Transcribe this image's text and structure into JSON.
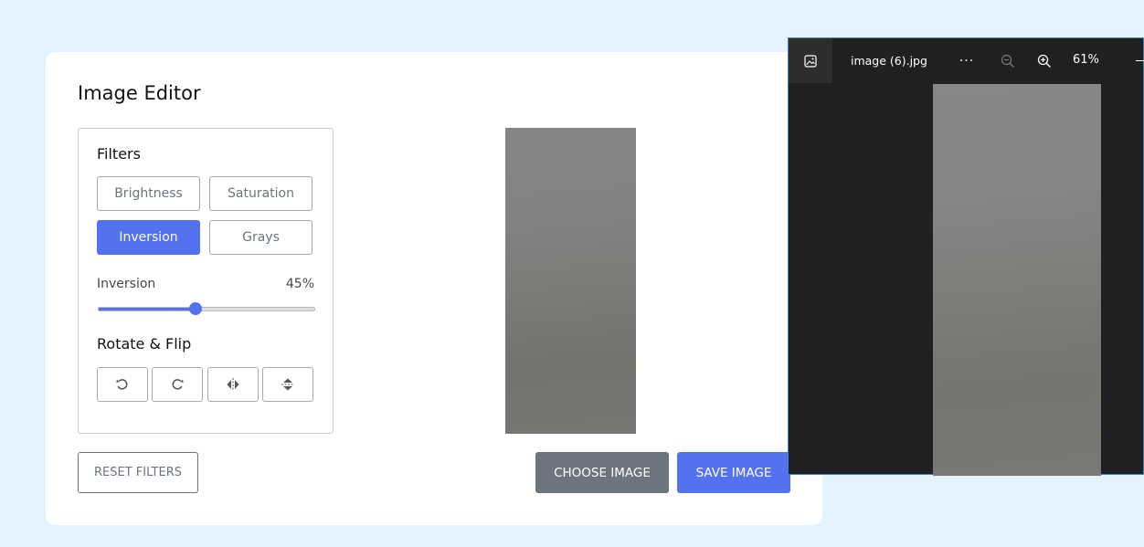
{
  "editor": {
    "title": "Image Editor",
    "filters": {
      "heading": "Filters",
      "buttons": [
        "Brightness",
        "Saturation",
        "Inversion",
        "Grays"
      ],
      "active": "Inversion"
    },
    "slider": {
      "name": "Inversion",
      "value_label": "45%",
      "value": 45
    },
    "rotate": {
      "heading": "Rotate & Flip",
      "icons": [
        "rotate-left-icon",
        "rotate-right-icon",
        "flip-horizontal-icon",
        "flip-vertical-icon"
      ]
    },
    "reset_label": "RESET FILTERS",
    "choose_label": "CHOOSE IMAGE",
    "save_label": "SAVE IMAGE"
  },
  "viewer": {
    "file_name": "image (6).jpg",
    "more_label": "...",
    "zoom": "61%"
  },
  "colors": {
    "accent": "#5372f0",
    "secondary": "#6c757d",
    "background": "#e3f2fd"
  }
}
